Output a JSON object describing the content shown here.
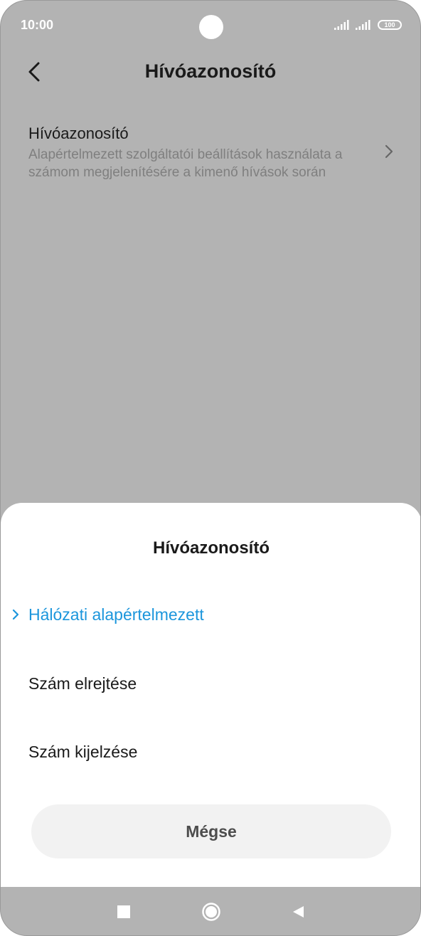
{
  "status_bar": {
    "time": "10:00",
    "battery": "100",
    "icons": [
      "signal-icon",
      "signal-icon",
      "battery-icon"
    ]
  },
  "header": {
    "title": "Hívóazonosító",
    "back_icon": "back-arrow-icon"
  },
  "setting": {
    "title": "Hívóazonosító",
    "description": "Alapértelmezett szolgáltatói beállítások használata a számom megjelenítésére a kimenő hívások során",
    "chevron_icon": "chevron-right-icon"
  },
  "dialog": {
    "title": "Hívóazonosító",
    "options": [
      {
        "label": "Hálózati alapértelmezett",
        "selected": true
      },
      {
        "label": "Szám elrejtése",
        "selected": false
      },
      {
        "label": "Szám kijelzése",
        "selected": false
      }
    ],
    "cancel_label": "Mégse"
  },
  "nav_bar": {
    "icons": [
      "recent-apps-icon",
      "home-icon",
      "back-icon"
    ]
  },
  "colors": {
    "accent": "#1c96dc",
    "overlay": "#b3b3b3",
    "sheet": "#ffffff"
  }
}
